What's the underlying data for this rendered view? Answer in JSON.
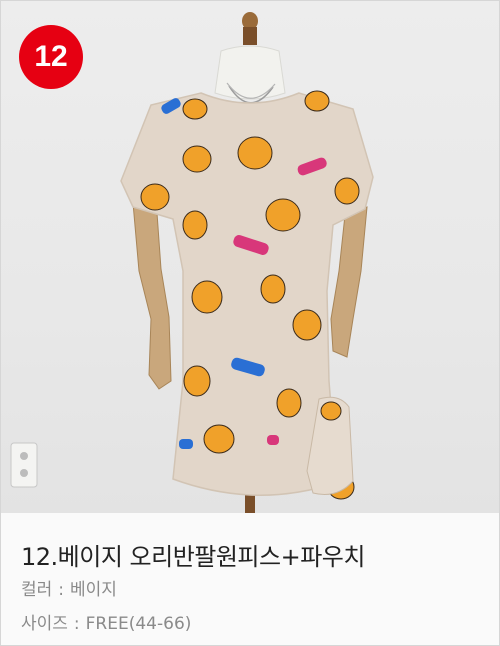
{
  "product": {
    "badge_number": "12",
    "title": "12.베이지 오리반팔원피스+파우치",
    "color_label": "컬러",
    "color_value": "베이지",
    "size_label": "사이즈",
    "size_value": "FREE(44-66)",
    "separator": ":"
  },
  "colors": {
    "badge": "#e60012",
    "dress": "#e2d6c9",
    "duck": "#f0a12a",
    "background": "#ebebeb"
  }
}
